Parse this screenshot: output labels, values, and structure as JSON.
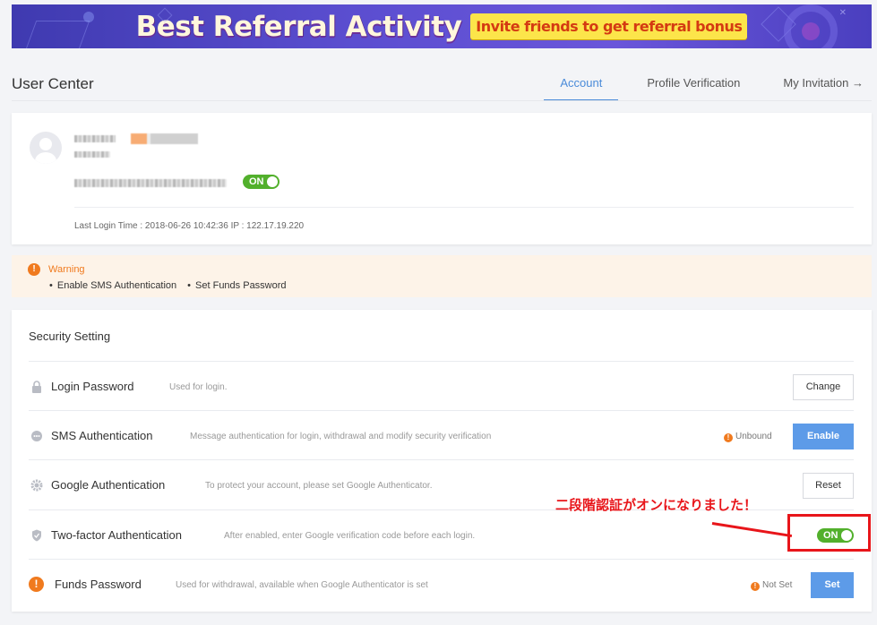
{
  "banner": {
    "title": "Best Referral Activity",
    "badge": "Invite friends to get  referral bonus"
  },
  "header": {
    "title": "User Center",
    "tabs": [
      {
        "label": "Account",
        "active": true
      },
      {
        "label": "Profile Verification",
        "active": false
      },
      {
        "label": "My Invitation →",
        "active": false
      }
    ]
  },
  "user": {
    "toggle_label": "ON",
    "last_login": "Last Login Time :  2018-06-26 10:42:36   IP :  122.17.19.220"
  },
  "warning": {
    "icon": "!",
    "title": "Warning",
    "items": [
      "Enable SMS Authentication",
      "Set Funds Password"
    ]
  },
  "security": {
    "title": "Security Setting",
    "rows": [
      {
        "icon": "lock-icon",
        "name": "Login Password",
        "desc": "Used for login.",
        "button": "Change"
      },
      {
        "icon": "sms-icon",
        "name": "SMS Authentication",
        "desc": "Message authentication for login, withdrawal and modify security verification",
        "status": "Unbound",
        "button": "Enable"
      },
      {
        "icon": "gear-icon",
        "name": "Google Authentication",
        "desc": "To protect your account, please set Google Authenticator.",
        "button": "Reset"
      },
      {
        "icon": "shield-icon",
        "name": "Two-factor Authentication",
        "desc": "After enabled, enter Google verification code before each login.",
        "toggle": "ON"
      },
      {
        "icon": "warning-icon",
        "name": "Funds Password",
        "desc": "Used for withdrawal, available when Google Authenticator is set",
        "status": "Not Set",
        "button": "Set"
      }
    ]
  },
  "annotation": {
    "text": "二段階認証がオンになりました！"
  },
  "colors": {
    "accent": "#4a8bd9",
    "primary_button": "#5d9be8",
    "toggle_on": "#52b02c",
    "warning": "#f07a1e",
    "annotation": "#e8151a"
  }
}
